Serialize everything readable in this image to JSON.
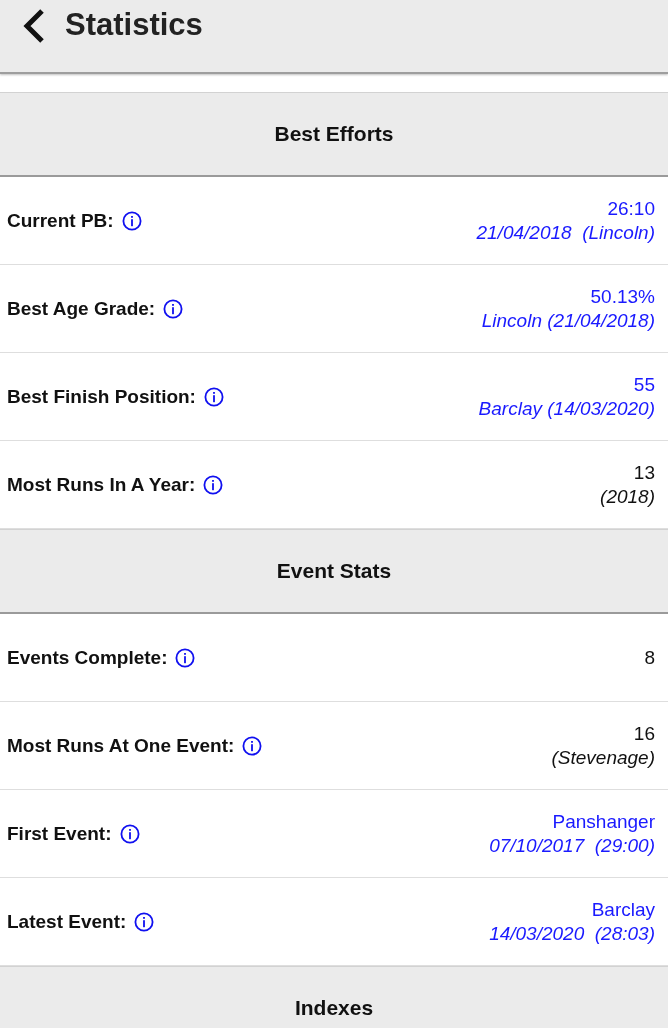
{
  "header": {
    "title": "Statistics"
  },
  "sections": [
    {
      "title": "Best Efforts",
      "rows": [
        {
          "label": "Current PB:",
          "link": true,
          "value": "26:10",
          "detail": "21/04/2018  (Lincoln)"
        },
        {
          "label": "Best Age Grade:",
          "link": true,
          "value": "50.13%",
          "detail": "Lincoln (21/04/2018)"
        },
        {
          "label": "Best Finish Position:",
          "link": true,
          "value": "55",
          "detail": "Barclay (14/03/2020)"
        },
        {
          "label": "Most Runs In A Year:",
          "link": false,
          "value": "13",
          "detail": "(2018)"
        }
      ]
    },
    {
      "title": "Event Stats",
      "rows": [
        {
          "label": "Events Complete:",
          "link": false,
          "value": "8"
        },
        {
          "label": "Most Runs At One Event:",
          "link": false,
          "value": "16",
          "detail": "(Stevenage)"
        },
        {
          "label": "First Event:",
          "link": true,
          "value": "Panshanger",
          "detail": "07/10/2017  (29:00)"
        },
        {
          "label": "Latest Event:",
          "link": true,
          "value": "Barclay",
          "detail": "14/03/2020  (28:03)"
        }
      ]
    },
    {
      "title": "Indexes"
    }
  ]
}
